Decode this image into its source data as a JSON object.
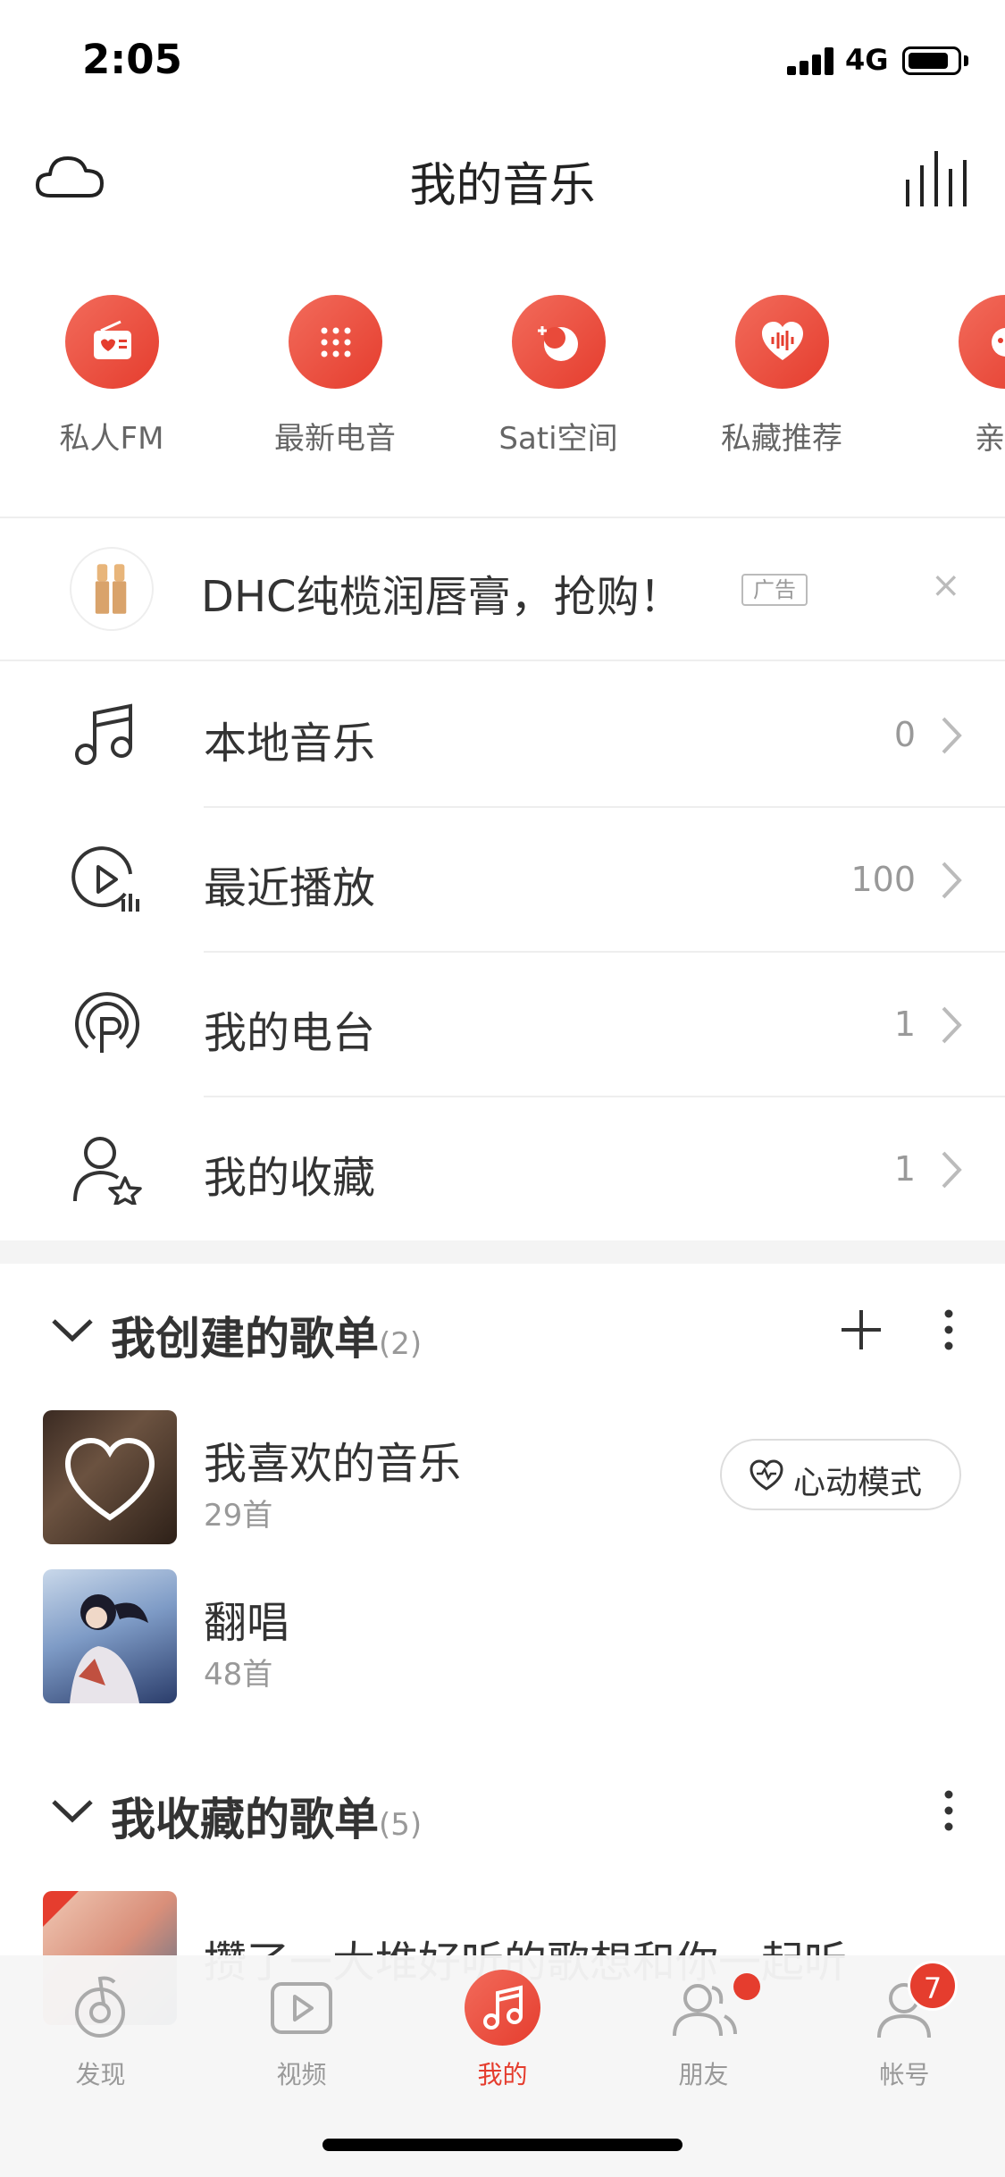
{
  "status": {
    "time": "2:05",
    "network": "4G"
  },
  "nav": {
    "title": "我的音乐"
  },
  "quick": [
    {
      "label": "私人FM",
      "icon": "radio-icon"
    },
    {
      "label": "最新电音",
      "icon": "dots-grid-icon"
    },
    {
      "label": "Sati空间",
      "icon": "moon-icon"
    },
    {
      "label": "私藏推荐",
      "icon": "heart-wave-icon"
    },
    {
      "label": "亲子",
      "icon": "kids-icon"
    }
  ],
  "ad": {
    "text": "DHC纯榄润唇膏，抢购！",
    "badge": "广告",
    "close": "×"
  },
  "rows": [
    {
      "label": "本地音乐",
      "count": "0",
      "icon": "music-note-icon"
    },
    {
      "label": "最近播放",
      "count": "100",
      "icon": "recent-play-icon"
    },
    {
      "label": "我的电台",
      "count": "1",
      "icon": "podcast-icon"
    },
    {
      "label": "我的收藏",
      "count": "1",
      "icon": "user-star-icon"
    }
  ],
  "created": {
    "title": "我创建的歌单",
    "count": "(2)",
    "playlists": [
      {
        "name": "我喜欢的音乐",
        "sub": "29首"
      },
      {
        "name": "翻唱",
        "sub": "48首"
      }
    ],
    "heart_mode": "心动模式"
  },
  "collected": {
    "title": "我收藏的歌单",
    "count": "(5)",
    "first": "攒了一大堆好听的歌想和你一起听"
  },
  "tabs": [
    {
      "label": "发现",
      "icon": "discover-icon"
    },
    {
      "label": "视频",
      "icon": "video-icon"
    },
    {
      "label": "我的",
      "icon": "my-music-icon"
    },
    {
      "label": "朋友",
      "icon": "friends-icon"
    },
    {
      "label": "帐号",
      "icon": "account-icon"
    }
  ],
  "account_badge": "7",
  "colors": {
    "accent": "#e53d2e"
  }
}
